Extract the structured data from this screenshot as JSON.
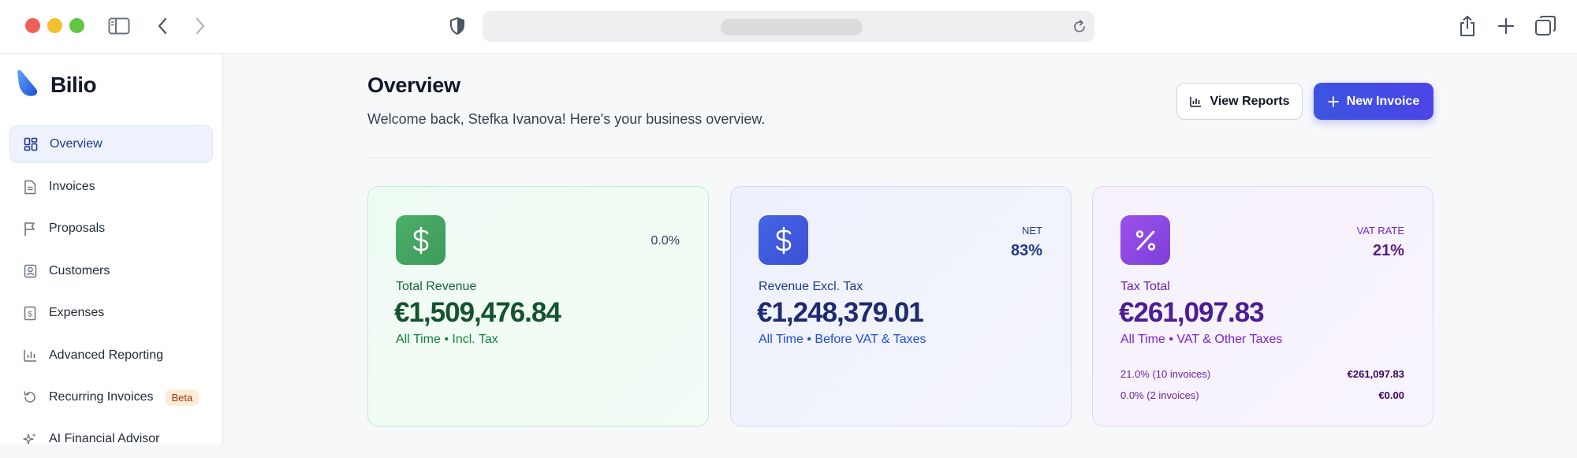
{
  "browser": {
    "colors": {
      "close": "#ee5f57",
      "minimize": "#f5bd30",
      "maximize": "#5fc640"
    },
    "icons": [
      "sidebar-toggle-icon",
      "back-icon",
      "forward-icon",
      "shield-icon",
      "reload-icon",
      "share-icon",
      "new-tab-icon",
      "tabs-overview-icon"
    ]
  },
  "brand": {
    "name": "Bilio",
    "logo_icon": "bilio-logo-icon",
    "accent": "#2563eb"
  },
  "sidebar": {
    "items": [
      {
        "label": "Overview",
        "icon": "grid-icon",
        "active": true
      },
      {
        "label": "Invoices",
        "icon": "document-icon"
      },
      {
        "label": "Proposals",
        "icon": "flag-icon"
      },
      {
        "label": "Customers",
        "icon": "contact-icon"
      },
      {
        "label": "Expenses",
        "icon": "receipt-icon"
      },
      {
        "label": "Advanced Reporting",
        "icon": "bar-chart-icon"
      },
      {
        "label": "Recurring Invoices",
        "icon": "recurring-icon",
        "badge": "Beta"
      },
      {
        "label": "AI Financial Advisor",
        "icon": "sparkle-icon"
      }
    ]
  },
  "header": {
    "title": "Overview",
    "subtitle": "Welcome back, Stefka Ivanova! Here's your business overview.",
    "view_reports_label": "View Reports",
    "new_invoice_label": "New Invoice"
  },
  "cards": {
    "revenue": {
      "icon": "dollar-icon",
      "change": "0.0%",
      "label": "Total Revenue",
      "value": "€1,509,476.84",
      "note": "All Time • Incl. Tax",
      "color": "#3d9b5a"
    },
    "net": {
      "icon": "dollar-icon",
      "tag": "NET",
      "tag_value": "83%",
      "label": "Revenue Excl. Tax",
      "value": "€1,248,379.01",
      "note": "All Time • Before VAT & Taxes",
      "color": "#3d4fd6"
    },
    "tax": {
      "icon": "percent-icon",
      "tag": "VAT RATE",
      "tag_value": "21%",
      "label": "Tax Total",
      "value": "€261,097.83",
      "note": "All Time • VAT & Other Taxes",
      "color": "#7e3fd9",
      "breakdown": [
        {
          "label": "21.0% (10 invoices)",
          "amount": "€261,097.83"
        },
        {
          "label": "0.0% (2 invoices)",
          "amount": "€0.00"
        }
      ]
    }
  }
}
